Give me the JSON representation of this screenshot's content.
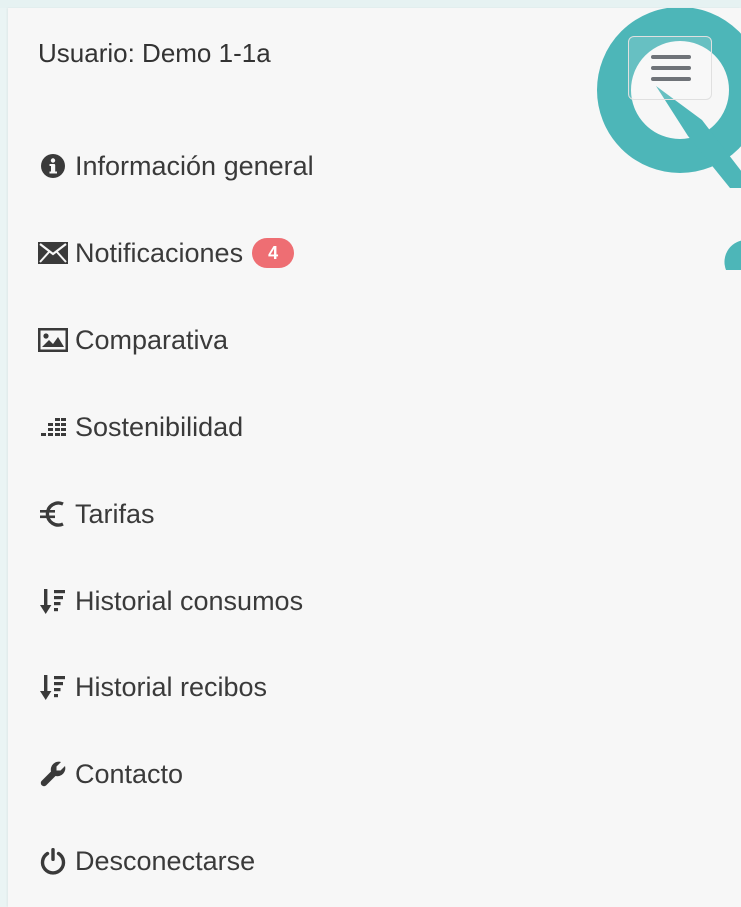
{
  "header": {
    "user_label": "Usuario: Demo 1-1a"
  },
  "menu_button": {
    "icon": "hamburger-icon"
  },
  "brand": {
    "logo_color": "#4db6b8"
  },
  "nav": {
    "items": [
      {
        "label": "Información general",
        "icon": "info-circle-icon"
      },
      {
        "label": "Notificaciones",
        "icon": "envelope-icon",
        "badge": "4"
      },
      {
        "label": "Comparativa",
        "icon": "picture-icon"
      },
      {
        "label": "Sostenibilidad",
        "icon": "bar-grid-icon"
      },
      {
        "label": "Tarifas",
        "icon": "euro-icon"
      },
      {
        "label": "Historial consumos",
        "icon": "sort-amount-down-icon"
      },
      {
        "label": "Historial recibos",
        "icon": "sort-amount-down-icon"
      },
      {
        "label": "Contacto",
        "icon": "wrench-icon"
      },
      {
        "label": "Desconectarse",
        "icon": "power-icon"
      }
    ]
  },
  "colors": {
    "badge": "#ee6e73",
    "text": "#3a3a3a",
    "panel": "#f7f7f7"
  }
}
